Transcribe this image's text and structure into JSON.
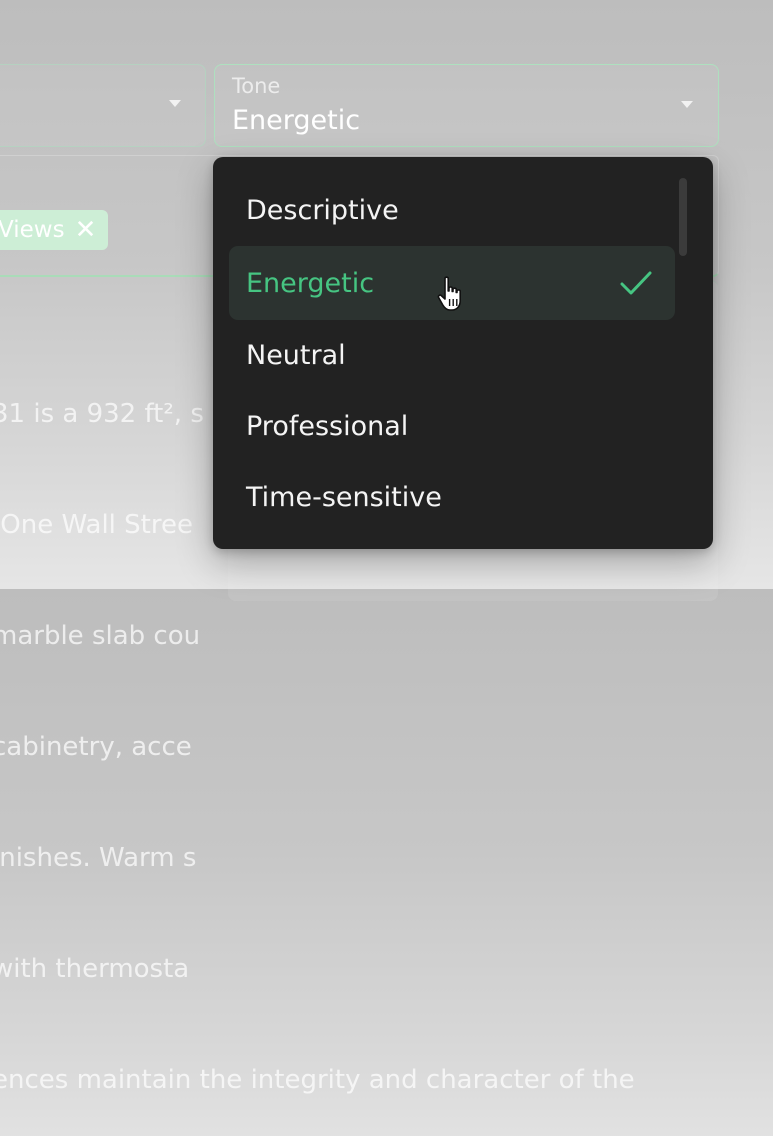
{
  "left_select": {
    "icon": "chevron-down-icon"
  },
  "tone": {
    "label": "Tone",
    "value": "Energetic",
    "icon": "chevron-down-icon"
  },
  "chip": {
    "label": "Views",
    "remove_icon": "close-icon"
  },
  "description_lines": [
    "31 is a 932 ft², s",
    " One Wall Stree",
    "marble slab cou",
    "cabinetry, acce",
    "inishes. Warm s",
    "with thermosta",
    "ences maintain the integrity and character of the"
  ],
  "dropdown": {
    "options": [
      {
        "label": "Descriptive",
        "selected": false
      },
      {
        "label": "Energetic",
        "selected": true
      },
      {
        "label": "Neutral",
        "selected": false
      },
      {
        "label": "Professional",
        "selected": false
      },
      {
        "label": "Time-sensitive",
        "selected": false
      }
    ],
    "selected_icon": "checkmark-icon"
  },
  "colors": {
    "accent_green": "#46c582",
    "dropdown_bg": "#222222",
    "selected_bg": "#2c3330",
    "field_border": "#aee0bf"
  },
  "cursor": "hand-pointer-icon"
}
